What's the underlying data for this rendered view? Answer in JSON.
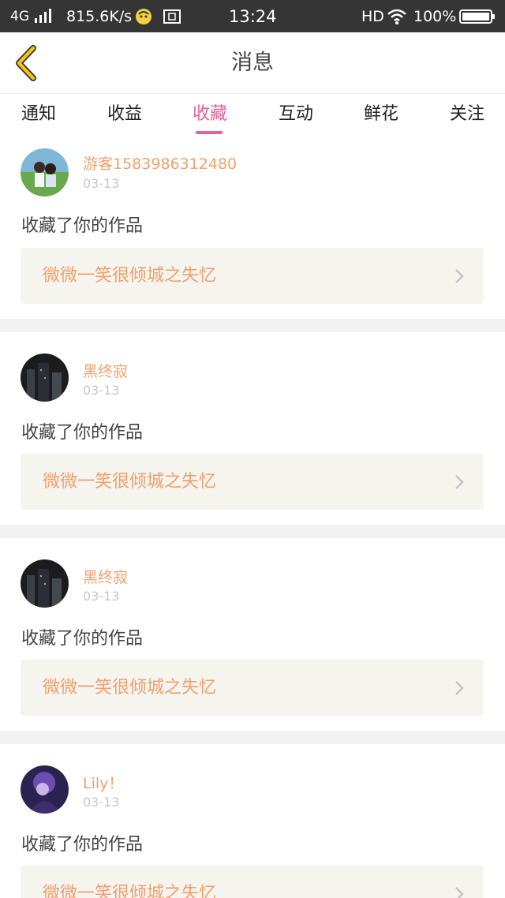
{
  "status_bar": {
    "network": "4G",
    "speed": "815.6K/s",
    "time": "13:24",
    "hd": "HD",
    "battery": "100%"
  },
  "header": {
    "title": "消息"
  },
  "tabs": [
    {
      "label": "通知"
    },
    {
      "label": "收益"
    },
    {
      "label": "收藏",
      "active": true
    },
    {
      "label": "互动"
    },
    {
      "label": "鲜花"
    },
    {
      "label": "关注"
    }
  ],
  "messages": [
    {
      "username": "游客1583986312480",
      "date": "03-13",
      "action": "收藏了你的作品",
      "work_title": "微微一笑很倾城之失忆"
    },
    {
      "username": "黑终寂",
      "date": "03-13",
      "action": "收藏了你的作品",
      "work_title": "微微一笑很倾城之失忆"
    },
    {
      "username": "黑终寂",
      "date": "03-13",
      "action": "收藏了你的作品",
      "work_title": "微微一笑很倾城之失忆"
    },
    {
      "username": "Lily！",
      "date": "03-13",
      "action": "收藏了你的作品",
      "work_title": "微微一笑很倾城之失忆"
    }
  ],
  "colors": {
    "accent": "#e4609a",
    "username": "#f2a06c",
    "work_bg": "#f5f4ef",
    "back_icon": "#f0c419"
  }
}
